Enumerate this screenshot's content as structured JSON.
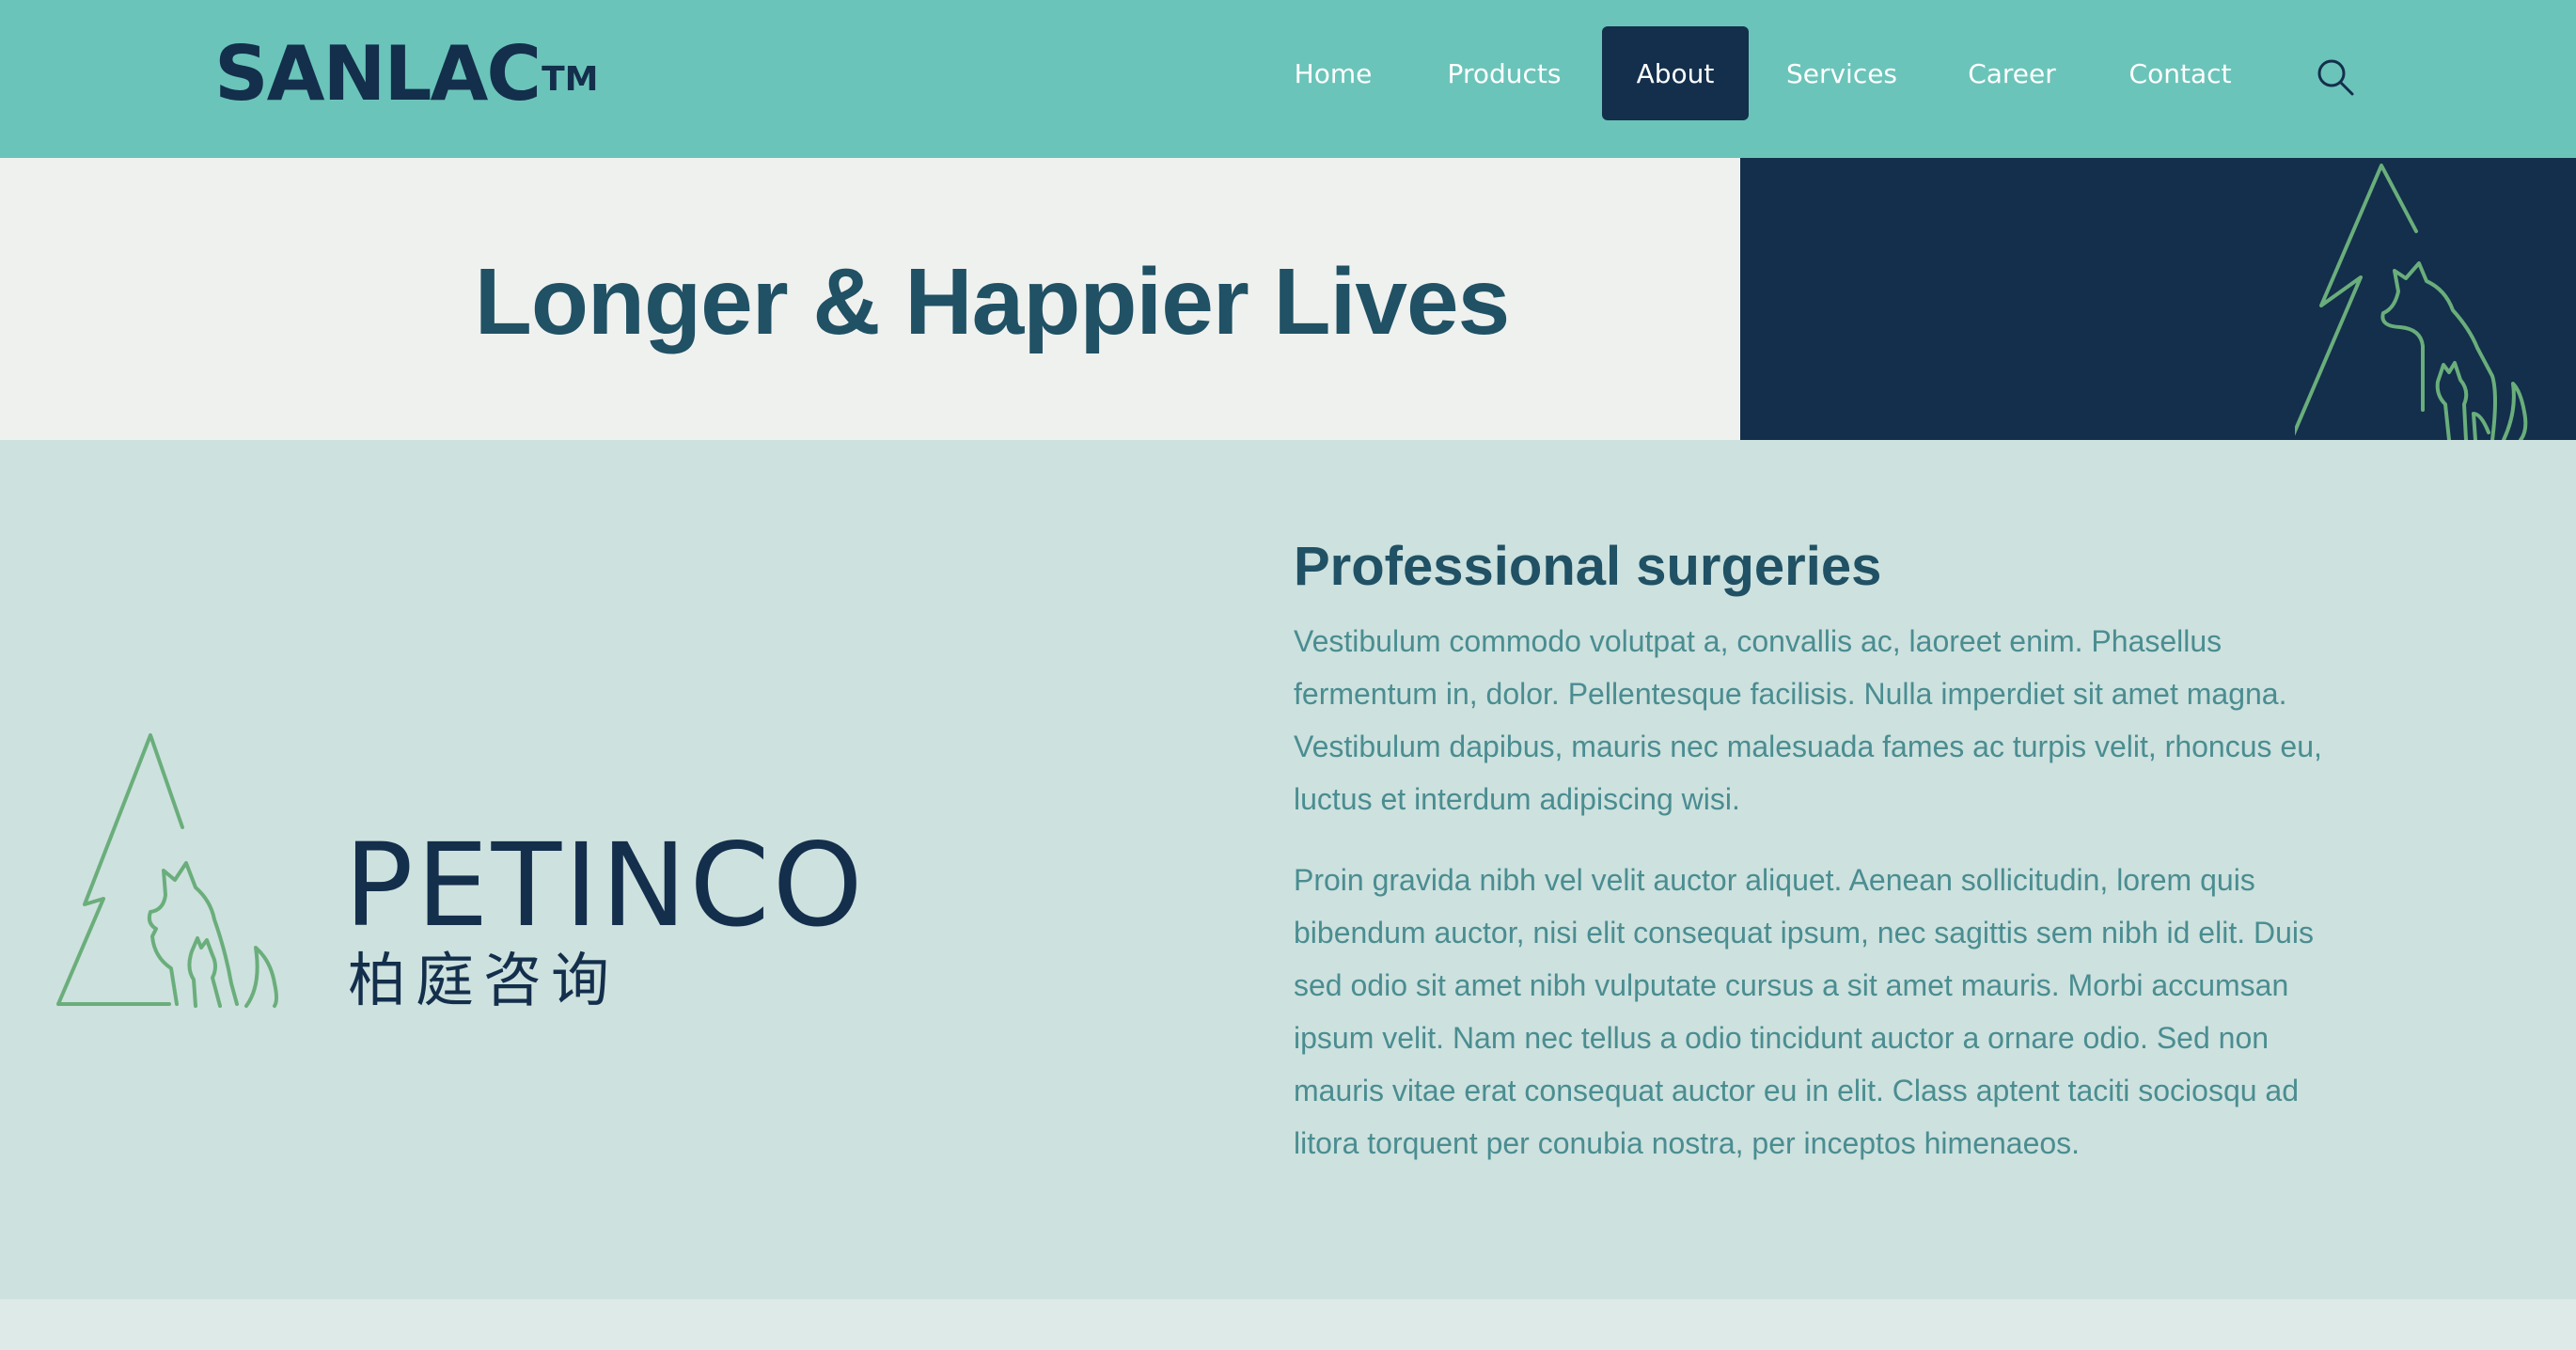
{
  "colors": {
    "header_bg": "#6bc4b9",
    "navy": "#132f4c",
    "hero_left_bg": "#eff1ef",
    "hero_title": "#205164",
    "section_bg": "#cde1de",
    "body_text": "#4a8d91",
    "logo_green": "#6aae7b"
  },
  "header": {
    "brand": "SANLAC",
    "brand_mark": "TM",
    "nav": [
      {
        "label": "Home",
        "active": false
      },
      {
        "label": "Products",
        "active": false
      },
      {
        "label": "About",
        "active": true
      },
      {
        "label": "Services",
        "active": false
      },
      {
        "label": "Career",
        "active": false
      },
      {
        "label": "Contact",
        "active": false
      }
    ],
    "search_icon": "search-icon"
  },
  "hero": {
    "title": "Longer & Happier Lives",
    "decoration_icon": "tree-dog-cat-icon"
  },
  "main": {
    "logo": {
      "name": "PETINCO",
      "subtitle": "柏庭咨询",
      "icon": "tree-dog-cat-icon"
    },
    "section_title": "Professional surgeries",
    "paragraphs": [
      "Vestibulum commodo volutpat a, convallis ac, laoreet enim. Phasellus fermentum in, dolor. Pellentesque facilisis. Nulla imperdiet sit amet magna. Vestibulum dapibus, mauris nec malesuada fames ac turpis velit, rhoncus eu, luctus et interdum adipiscing wisi.",
      "Proin gravida nibh vel velit auctor aliquet. Aenean sollicitudin, lorem quis bibendum auctor, nisi elit consequat ipsum, nec sagittis sem nibh id elit. Duis sed odio sit amet nibh vulputate cursus a sit amet mauris. Morbi accumsan ipsum velit. Nam nec tellus a odio tincidunt auctor a ornare odio. Sed non mauris vitae erat consequat auctor eu in elit. Class aptent taciti sociosqu ad litora torquent per conubia nostra, per inceptos himenaeos."
    ]
  }
}
